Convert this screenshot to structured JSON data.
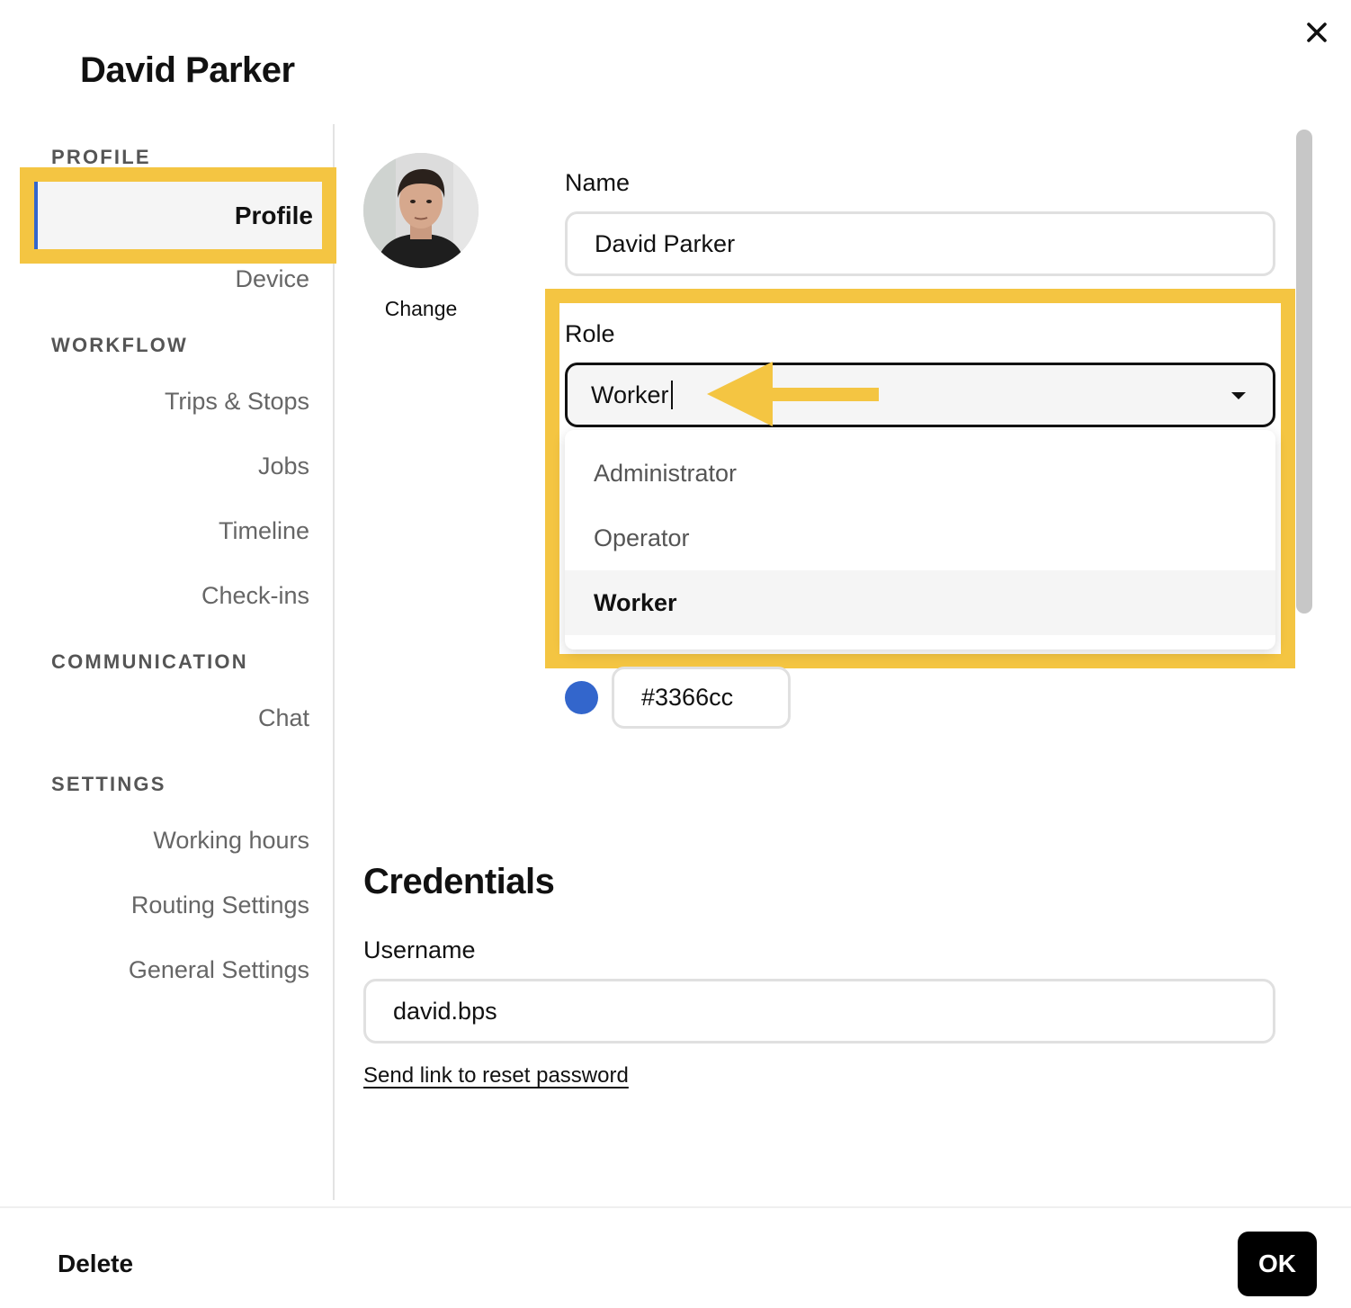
{
  "dialog": {
    "title": "David Parker",
    "close_icon": "close-icon"
  },
  "sidebar": {
    "sections": [
      {
        "label": "PROFILE",
        "items": [
          "Profile",
          "Device"
        ]
      },
      {
        "label": "WORKFLOW",
        "items": [
          "Trips & Stops",
          "Jobs",
          "Timeline",
          "Check-ins"
        ]
      },
      {
        "label": "COMMUNICATION",
        "items": [
          "Chat"
        ]
      },
      {
        "label": "SETTINGS",
        "items": [
          "Working hours",
          "Routing Settings",
          "General Settings"
        ]
      }
    ],
    "active_item": "Profile",
    "accent_color": "#3366cc"
  },
  "profile": {
    "avatar_icon": "avatar-photo",
    "change_label": "Change",
    "name_label": "Name",
    "name_value": "David Parker",
    "role_label": "Role",
    "role_value": "Worker",
    "role_options": [
      "Administrator",
      "Operator",
      "Worker"
    ],
    "role_selected": "Worker",
    "color_value": "#3366cc"
  },
  "credentials": {
    "title": "Credentials",
    "username_label": "Username",
    "username_value": "david.bps",
    "reset_link": "Send link to reset password"
  },
  "footer": {
    "delete_label": "Delete",
    "ok_label": "OK"
  },
  "annotation": {
    "highlight_color": "#f4c542"
  }
}
